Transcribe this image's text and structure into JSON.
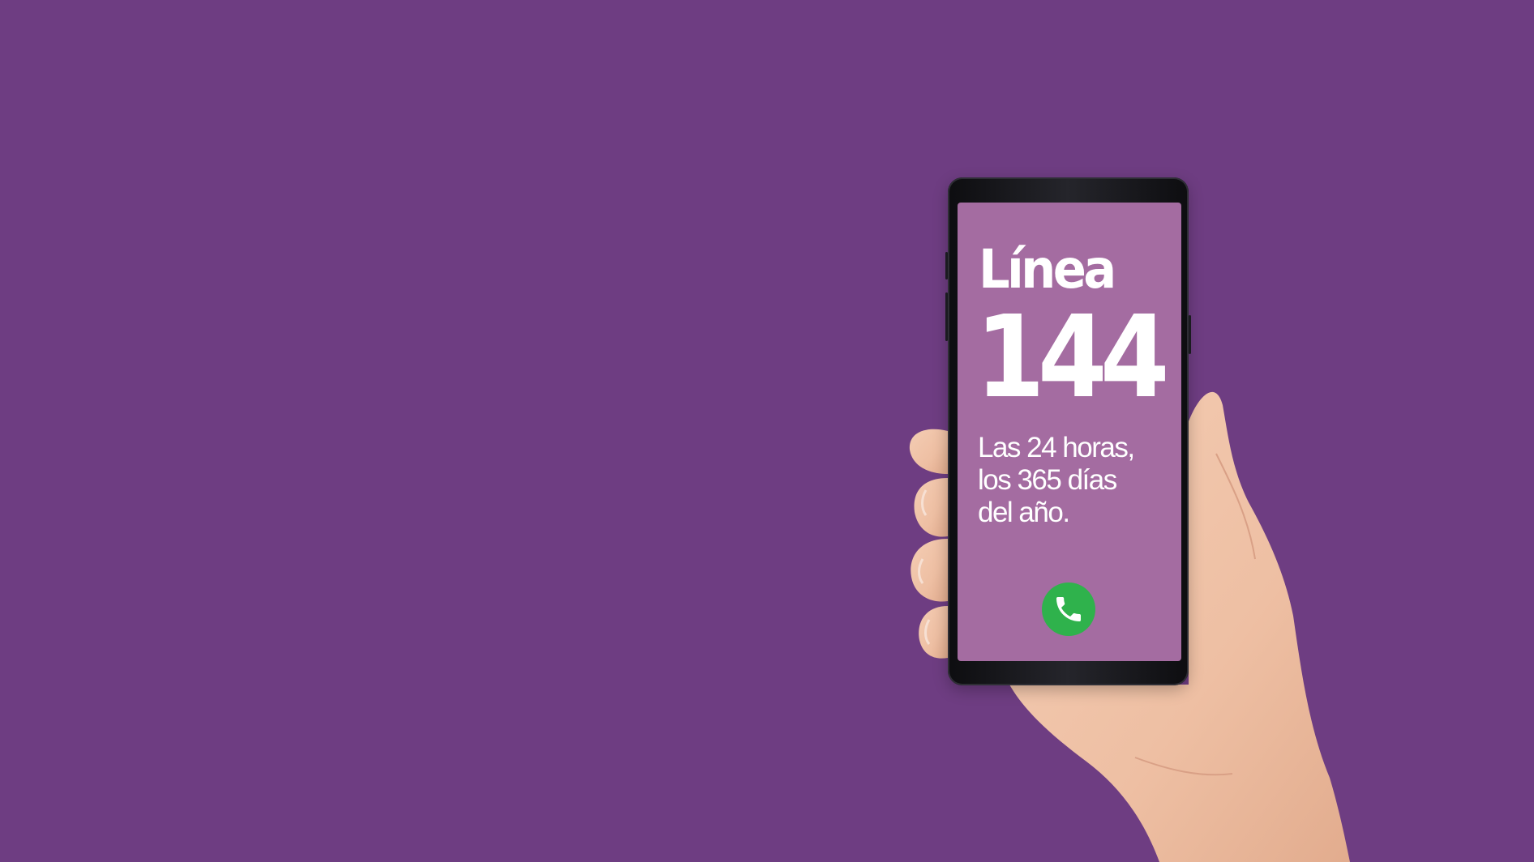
{
  "background_color": "#6e3d82",
  "phone": {
    "screen_color": "#a46ca1",
    "title": "Línea",
    "number": "144",
    "subtitle_lines": [
      "Las 24 horas,",
      "los 365 días",
      "del año."
    ],
    "call_icon": "phone-call-icon",
    "call_button_color": "#2fb24c"
  }
}
